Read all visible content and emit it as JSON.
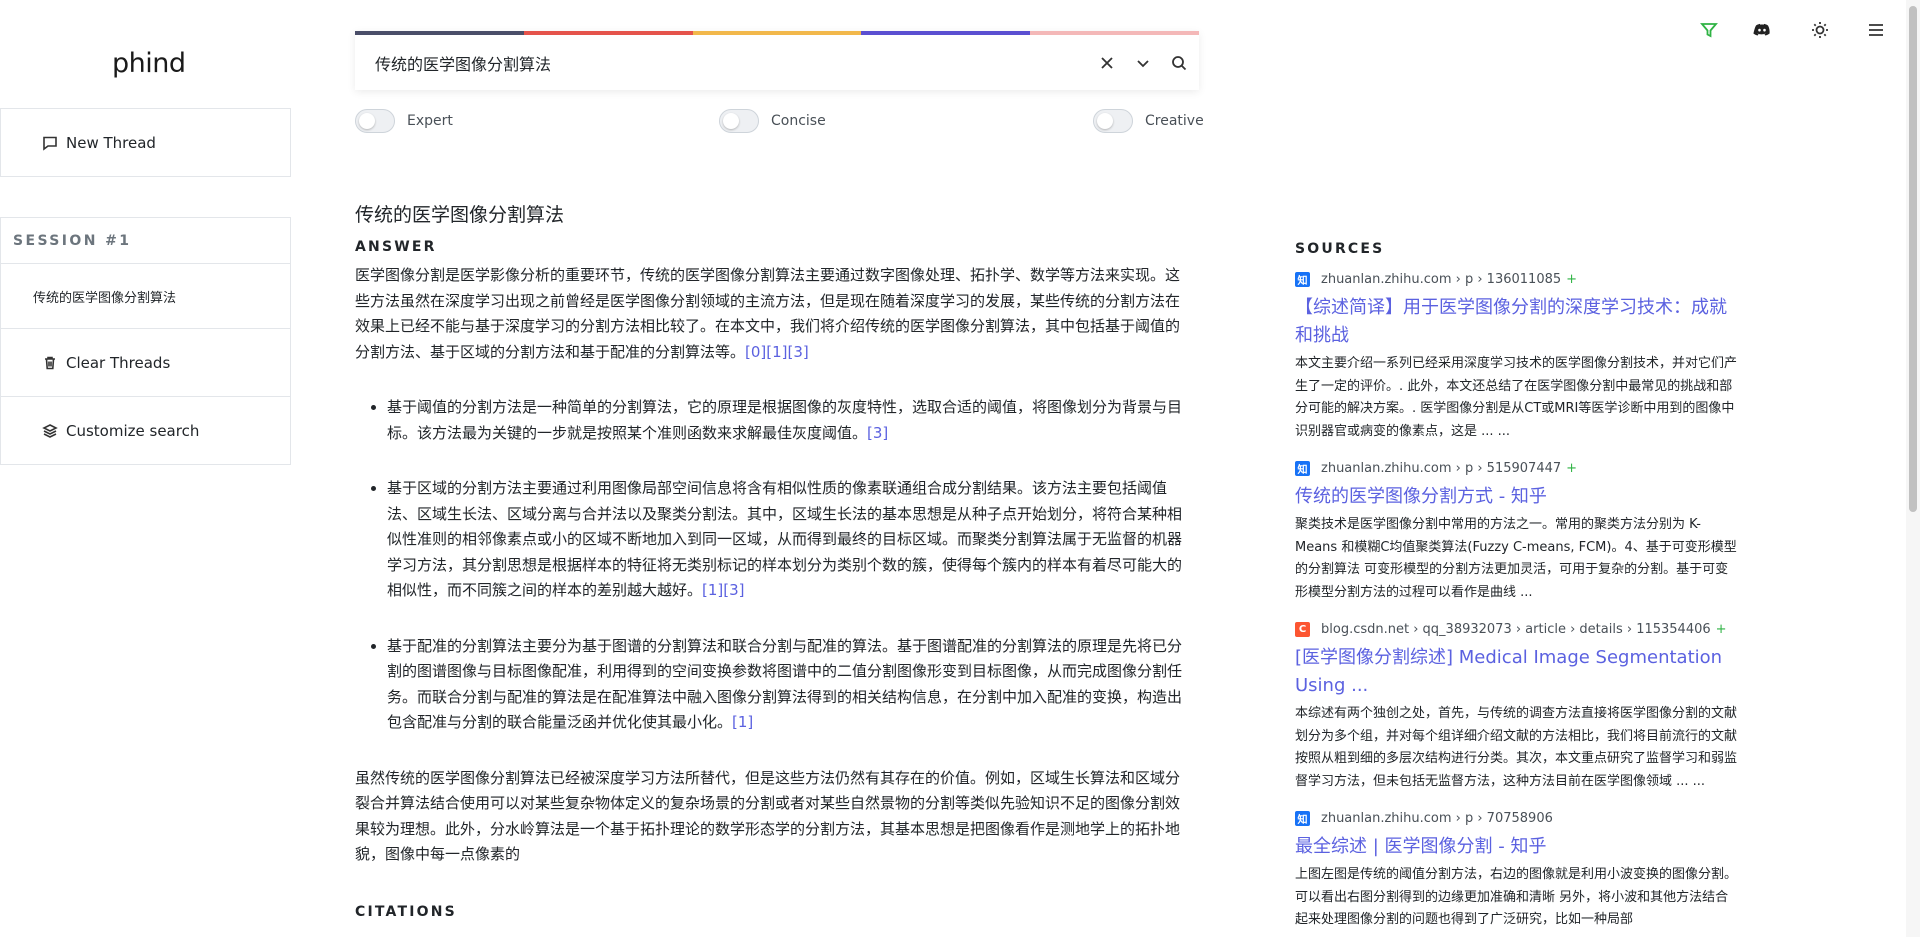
{
  "brand": {
    "logo": "phind"
  },
  "sidebar": {
    "new_thread": "New Thread",
    "session_label": "SESSION #1",
    "threads": [
      "传统的医学图像分割算法"
    ],
    "clear_threads": "Clear Threads",
    "customize_search": "Customize search"
  },
  "search": {
    "value": "传统的医学图像分割算法",
    "bar_colors": [
      "#4a4e69",
      "#e5534b",
      "#f2b84b",
      "#5b4fd1",
      "#f4b8b8"
    ]
  },
  "toggles": {
    "expert": "Expert",
    "concise": "Concise",
    "creative": "Creative"
  },
  "topbar": {
    "icons": [
      "filter-icon",
      "discord-icon",
      "sun-icon",
      "menu-icon"
    ],
    "accent": "#2fb344"
  },
  "main": {
    "query_title": "传统的医学图像分割算法",
    "answer_label": "ANSWER",
    "intro": "医学图像分割是医学影像分析的重要环节，传统的医学图像分割算法主要通过数字图像处理、拓扑学、数学等方法来实现。这些方法虽然在深度学习出现之前曾经是医学图像分割领域的主流方法，但是现在随着深度学习的发展，某些传统的分割方法在效果上已经不能与基于深度学习的分割方法相比较了。在本文中，我们将介绍传统的医学图像分割算法，其中包括基于阈值的分割方法、基于区域的分割方法和基于配准的分割算法等。",
    "intro_cite": "[0][1][3]",
    "bullets": [
      {
        "text": "基于阈值的分割方法是一种简单的分割算法，它的原理是根据图像的灰度特性，选取合适的阈值，将图像划分为背景与目标。该方法最为关键的一步就是按照某个准则函数来求解最佳灰度阈值。",
        "cite": "[3]"
      },
      {
        "text": "基于区域的分割方法主要通过利用图像局部空间信息将含有相似性质的像素联通组合成分割结果。该方法主要包括阈值法、区域生长法、区域分离与合并法以及聚类分割法。其中，区域生长法的基本思想是从种子点开始划分，将符合某种相似性准则的相邻像素点或小的区域不断地加入到同一区域，从而得到最终的目标区域。而聚类分割算法属于无监督的机器学习方法，其分割思想是根据样本的特征将无类别标记的样本划分为类别个数的簇，使得每个簇内的样本有着尽可能大的相似性，而不同簇之间的样本的差别越大越好。",
        "cite": "[1][3]"
      },
      {
        "text": "基于配准的分割算法主要分为基于图谱的分割算法和联合分割与配准的算法。基于图谱配准的分割算法的原理是先将已分割的图谱图像与目标图像配准，利用得到的空间变换参数将图谱中的二值分割图像形变到目标图像，从而完成图像分割任务。而联合分割与配准的算法是在配准算法中融入图像分割算法得到的相关结构信息，在分割中加入配准的变换，构造出包含配准与分割的联合能量泛函并优化使其最小化。",
        "cite": "[1]"
      }
    ],
    "outro": "虽然传统的医学图像分割算法已经被深度学习方法所替代，但是这些方法仍然有其存在的价值。例如，区域生长算法和区域分裂合并算法结合使用可以对某些复杂物体定义的复杂场景的分割或者对某些自然景物的分割等类似先验知识不足的图像分割效果较为理想。此外，分水岭算法是一个基于拓扑理论的数学形态学的分割方法，其基本思想是把图像看作是测地学上的拓扑地貌，图像中每一点像素的",
    "citations_label": "CITATIONS"
  },
  "sources": {
    "label": "SOURCES",
    "items": [
      {
        "favicon": "知",
        "meta": "zhuanlan.zhihu.com › p › 136011085",
        "plus": "+",
        "title": "【综述简译】用于医学图像分割的深度学习技术：成就和挑战",
        "snippet": "本文主要介绍一系列已经采用深度学习技术的医学图像分割技术，并对它们产生了一定的评价。. 此外，本文还总结了在医学图像分割中最常见的挑战和部分可能的解决方案。. 医学图像分割是从CT或MRI等医学诊断中用到的图像中识别器官或病变的像素点，这是 ... ..."
      },
      {
        "favicon": "知",
        "meta": "zhuanlan.zhihu.com › p › 515907447",
        "plus": "+",
        "title": "传统的医学图像分割方式 - 知乎",
        "snippet": "聚类技术是医学图像分割中常用的方法之一。常用的聚类方法分别为 K-Means 和模糊C均值聚类算法(Fuzzy C-means, FCM)。4、基于可变形模型的分割算法 可变形模型的分割方法更加灵活，可用于复杂的分割。基于可变形模型分割方法的过程可以看作是曲线 ..."
      },
      {
        "favicon": "C",
        "meta": "blog.csdn.net › qq_38932073 › article › details › 115354406",
        "plus": "+",
        "title": "[医学图像分割综述] Medical Image Segmentation Using ...",
        "snippet": "本综述有两个独创之处，首先，与传统的调查方法直接将医学图像分割的文献划分为多个组，并对每个组详细介绍文献的方法相比，我们将目前流行的文献按照从粗到细的多层次结构进行分类。其次，本文重点研究了监督学习和弱监督学习方法，但未包括无监督方法，这种方法目前在医学图像领域 ... ..."
      },
      {
        "favicon": "知",
        "meta": "zhuanlan.zhihu.com › p › 70758906",
        "plus": "",
        "title": "最全综述 | 医学图像分割 - 知乎",
        "snippet": "上图左图是传统的阈值分割方法，右边的图像就是利用小波变换的图像分割。可以看出右图分割得到的边缘更加准确和清晰 另外，将小波和其他方法结合起来处理图像分割的问题也得到了广泛研究，比如一种局部"
      }
    ]
  }
}
